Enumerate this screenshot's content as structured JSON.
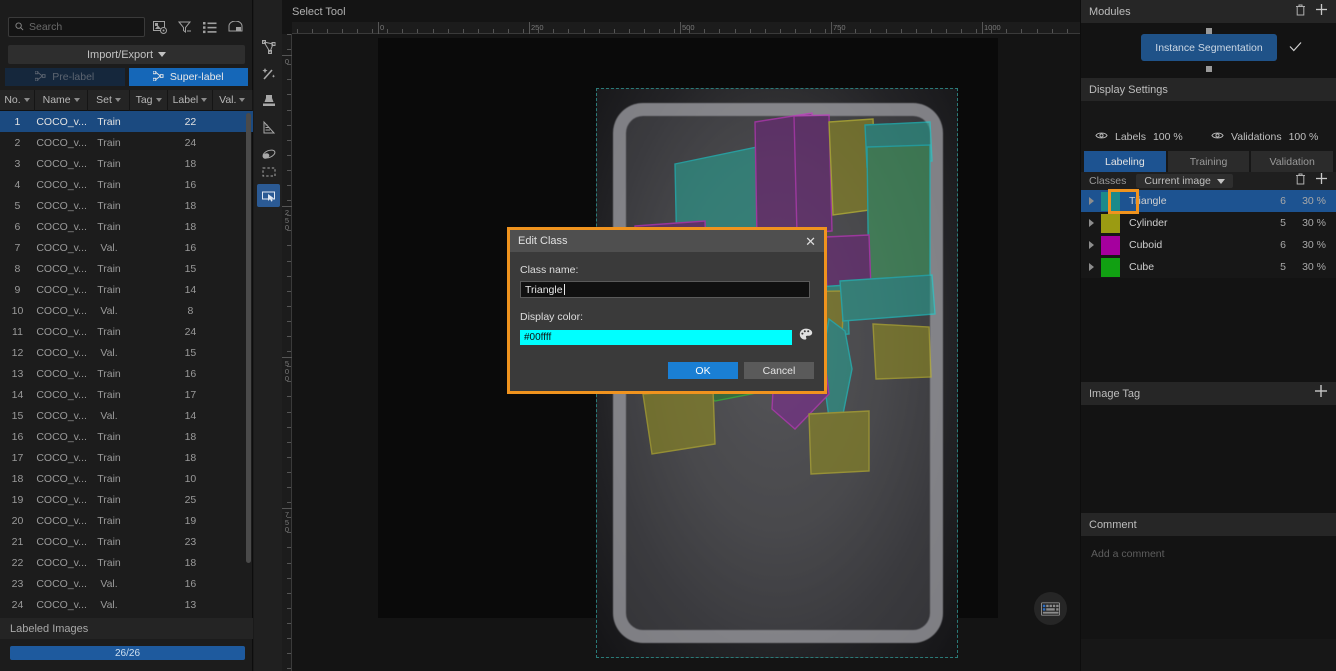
{
  "left_panel": {
    "search": {
      "placeholder": "Search",
      "value": ""
    },
    "toolbar_icons": [
      "image-settings-icon",
      "filter-icon",
      "list-icon",
      "panel-layout-icon"
    ],
    "import_export_label": "Import/Export",
    "prelabel_label": "Pre-label",
    "superlabel_label": "Super-label",
    "columns": [
      "No.",
      "Name",
      "Set",
      "Tag",
      "Label",
      "Val."
    ],
    "rows": [
      {
        "no": "1",
        "name": "COCO_v...",
        "set": "Train",
        "tag": "",
        "label": "22",
        "val": ""
      },
      {
        "no": "2",
        "name": "COCO_v...",
        "set": "Train",
        "tag": "",
        "label": "24",
        "val": ""
      },
      {
        "no": "3",
        "name": "COCO_v...",
        "set": "Train",
        "tag": "",
        "label": "18",
        "val": ""
      },
      {
        "no": "4",
        "name": "COCO_v...",
        "set": "Train",
        "tag": "",
        "label": "16",
        "val": ""
      },
      {
        "no": "5",
        "name": "COCO_v...",
        "set": "Train",
        "tag": "",
        "label": "18",
        "val": ""
      },
      {
        "no": "6",
        "name": "COCO_v...",
        "set": "Train",
        "tag": "",
        "label": "18",
        "val": ""
      },
      {
        "no": "7",
        "name": "COCO_v...",
        "set": "Val.",
        "tag": "",
        "label": "16",
        "val": ""
      },
      {
        "no": "8",
        "name": "COCO_v...",
        "set": "Train",
        "tag": "",
        "label": "15",
        "val": ""
      },
      {
        "no": "9",
        "name": "COCO_v...",
        "set": "Train",
        "tag": "",
        "label": "14",
        "val": ""
      },
      {
        "no": "10",
        "name": "COCO_v...",
        "set": "Val.",
        "tag": "",
        "label": "8",
        "val": ""
      },
      {
        "no": "11",
        "name": "COCO_v...",
        "set": "Train",
        "tag": "",
        "label": "24",
        "val": ""
      },
      {
        "no": "12",
        "name": "COCO_v...",
        "set": "Val.",
        "tag": "",
        "label": "15",
        "val": ""
      },
      {
        "no": "13",
        "name": "COCO_v...",
        "set": "Train",
        "tag": "",
        "label": "16",
        "val": ""
      },
      {
        "no": "14",
        "name": "COCO_v...",
        "set": "Train",
        "tag": "",
        "label": "17",
        "val": ""
      },
      {
        "no": "15",
        "name": "COCO_v...",
        "set": "Val.",
        "tag": "",
        "label": "14",
        "val": ""
      },
      {
        "no": "16",
        "name": "COCO_v...",
        "set": "Train",
        "tag": "",
        "label": "18",
        "val": ""
      },
      {
        "no": "17",
        "name": "COCO_v...",
        "set": "Train",
        "tag": "",
        "label": "18",
        "val": ""
      },
      {
        "no": "18",
        "name": "COCO_v...",
        "set": "Train",
        "tag": "",
        "label": "10",
        "val": ""
      },
      {
        "no": "19",
        "name": "COCO_v...",
        "set": "Train",
        "tag": "",
        "label": "25",
        "val": ""
      },
      {
        "no": "20",
        "name": "COCO_v...",
        "set": "Train",
        "tag": "",
        "label": "19",
        "val": ""
      },
      {
        "no": "21",
        "name": "COCO_v...",
        "set": "Train",
        "tag": "",
        "label": "23",
        "val": ""
      },
      {
        "no": "22",
        "name": "COCO_v...",
        "set": "Train",
        "tag": "",
        "label": "18",
        "val": ""
      },
      {
        "no": "23",
        "name": "COCO_v...",
        "set": "Val.",
        "tag": "",
        "label": "16",
        "val": ""
      },
      {
        "no": "24",
        "name": "COCO_v...",
        "set": "Val.",
        "tag": "",
        "label": "13",
        "val": ""
      }
    ],
    "selected_row_index": 0,
    "labeled_images_label": "Labeled Images",
    "progress_text": "26/26"
  },
  "tool_palette": {
    "tools": [
      {
        "name": "polygon-tool",
        "active": false
      },
      {
        "name": "magic-wand-tool",
        "active": false
      },
      {
        "name": "stamp-tool",
        "active": false
      },
      {
        "name": "ruler-tool",
        "active": false
      },
      {
        "name": "eraser-tool",
        "active": false
      },
      {
        "name": "marquee-tool",
        "active": false
      },
      {
        "name": "select-tool",
        "active": true
      }
    ]
  },
  "canvas": {
    "tool_label": "Select Tool",
    "h_ruler_labels": [
      "0",
      "250",
      "500",
      "750",
      "1000"
    ],
    "v_ruler_labels": [
      "0",
      "250",
      "500",
      "750"
    ],
    "keyboard_badge": "keyboard-icon"
  },
  "dialog": {
    "title": "Edit Class",
    "close_label": "✕",
    "class_name_label": "Class name:",
    "class_name_value": "Triangle",
    "display_color_label": "Display color:",
    "display_color_value": "#00ffff",
    "color_picker_icon": "palette-icon",
    "ok_label": "OK",
    "cancel_label": "Cancel",
    "accent_border": "#f0931e"
  },
  "right_panel": {
    "modules": {
      "title": "Modules",
      "delete_icon": "trash-icon",
      "add_icon": "plus-icon",
      "node_label": "Instance Segmentation",
      "check_icon": "check-icon"
    },
    "display_settings": {
      "title": "Display Settings",
      "labels_name": "Labels",
      "labels_value": "100 %",
      "validations_name": "Validations",
      "validations_value": "100 %"
    },
    "tabs": [
      {
        "label": "Labeling",
        "active": true
      },
      {
        "label": "Training",
        "active": false
      },
      {
        "label": "Validation",
        "active": false
      }
    ],
    "classes_section": {
      "label": "Classes",
      "scope_label": "Current image",
      "delete_icon": "trash-icon",
      "add_icon": "plus-icon",
      "items": [
        {
          "name": "Triangle",
          "color": "#1b8a8a",
          "count": "6",
          "percent": "30 %",
          "selected": true,
          "highlighted": true
        },
        {
          "name": "Cylinder",
          "color": "#9b9b12",
          "count": "5",
          "percent": "30 %",
          "selected": false,
          "highlighted": false
        },
        {
          "name": "Cuboid",
          "color": "#a5009e",
          "count": "6",
          "percent": "30 %",
          "selected": false,
          "highlighted": false
        },
        {
          "name": "Cube",
          "color": "#11a012",
          "count": "5",
          "percent": "30 %",
          "selected": false,
          "highlighted": false
        }
      ]
    },
    "image_tag": {
      "title": "Image Tag",
      "add_icon": "plus-icon"
    },
    "comment": {
      "title": "Comment",
      "placeholder": "Add a comment"
    }
  }
}
